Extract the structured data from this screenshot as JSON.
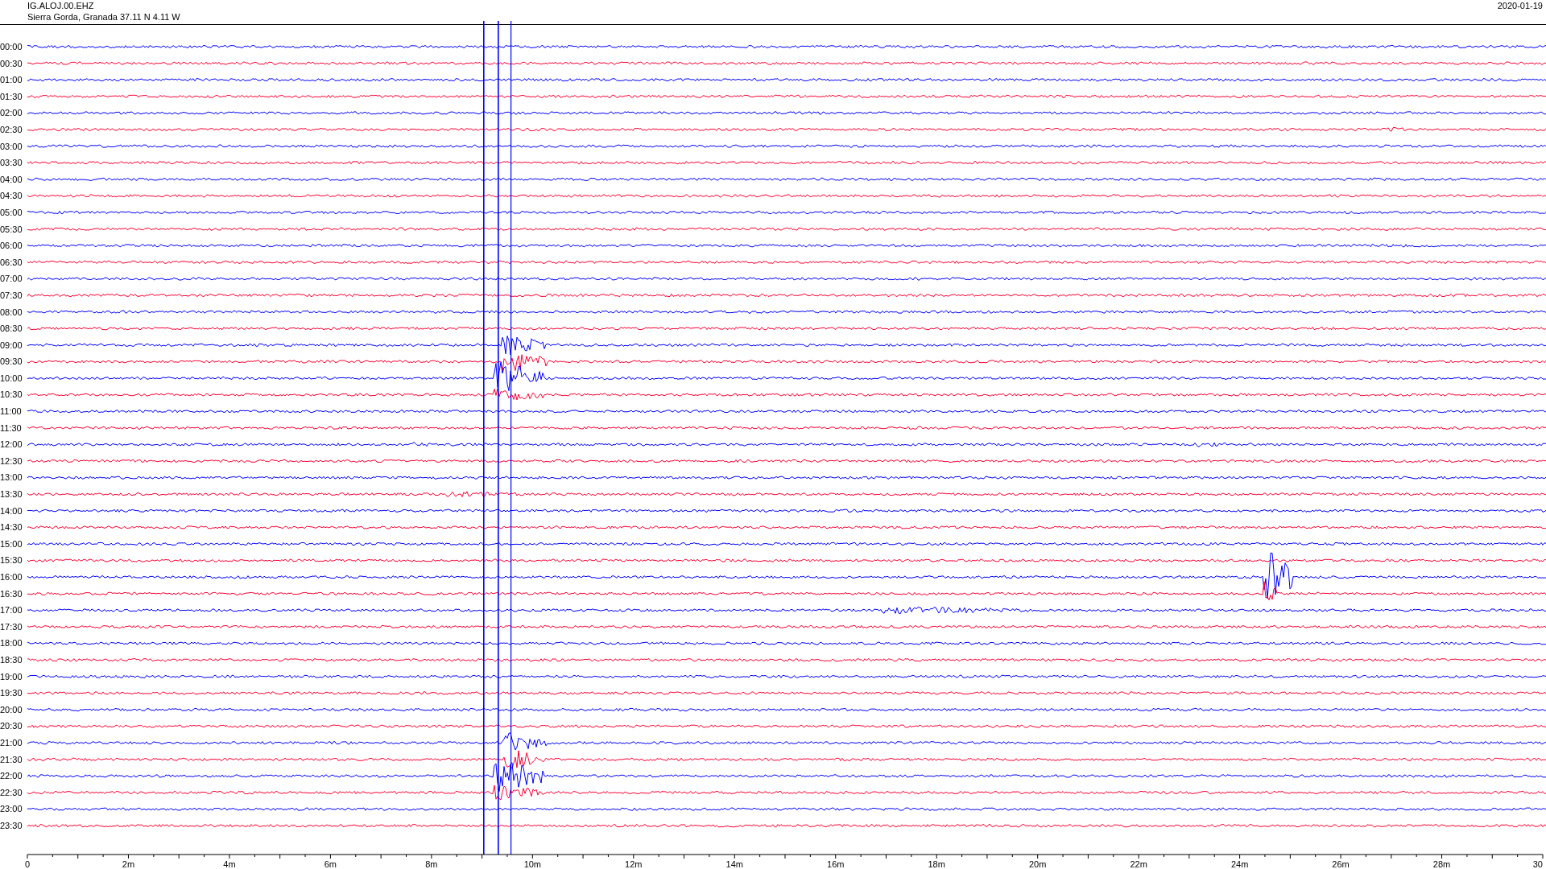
{
  "header": {
    "station": "IG.ALOJ.00.EHZ",
    "location": "Sierra Gorda, Granada  37.11 N 4.11 W",
    "date": "2020-01-19"
  },
  "rows": [
    {
      "time": "00:00",
      "color": "#0000ff"
    },
    {
      "time": "00:30",
      "color": "#ff0033"
    },
    {
      "time": "01:00",
      "color": "#0000ff"
    },
    {
      "time": "01:30",
      "color": "#ff0033"
    },
    {
      "time": "02:00",
      "color": "#0000ff"
    },
    {
      "time": "02:30",
      "color": "#ff0033"
    },
    {
      "time": "03:00",
      "color": "#0000ff"
    },
    {
      "time": "03:30",
      "color": "#ff0033"
    },
    {
      "time": "04:00",
      "color": "#0000ff"
    },
    {
      "time": "04:30",
      "color": "#ff0033"
    },
    {
      "time": "05:00",
      "color": "#0000ff"
    },
    {
      "time": "05:30",
      "color": "#ff0033"
    },
    {
      "time": "06:00",
      "color": "#0000ff"
    },
    {
      "time": "06:30",
      "color": "#ff0033"
    },
    {
      "time": "07:00",
      "color": "#0000ff"
    },
    {
      "time": "07:30",
      "color": "#ff0033"
    },
    {
      "time": "08:00",
      "color": "#0000ff"
    },
    {
      "time": "08:30",
      "color": "#ff0033"
    },
    {
      "time": "09:00",
      "color": "#0000ff"
    },
    {
      "time": "09:30",
      "color": "#ff0033"
    },
    {
      "time": "10:00",
      "color": "#0000ff"
    },
    {
      "time": "10:30",
      "color": "#ff0033"
    },
    {
      "time": "11:00",
      "color": "#0000ff"
    },
    {
      "time": "11:30",
      "color": "#ff0033"
    },
    {
      "time": "12:00",
      "color": "#0000ff"
    },
    {
      "time": "12:30",
      "color": "#ff0033"
    },
    {
      "time": "13:00",
      "color": "#0000ff"
    },
    {
      "time": "13:30",
      "color": "#ff0033"
    },
    {
      "time": "14:00",
      "color": "#0000ff"
    },
    {
      "time": "14:30",
      "color": "#ff0033"
    },
    {
      "time": "15:00",
      "color": "#0000ff"
    },
    {
      "time": "15:30",
      "color": "#ff0033"
    },
    {
      "time": "16:00",
      "color": "#0000ff"
    },
    {
      "time": "16:30",
      "color": "#ff0033"
    },
    {
      "time": "17:00",
      "color": "#0000ff"
    },
    {
      "time": "17:30",
      "color": "#ff0033"
    },
    {
      "time": "18:00",
      "color": "#0000ff"
    },
    {
      "time": "18:30",
      "color": "#ff0033"
    },
    {
      "time": "19:00",
      "color": "#0000ff"
    },
    {
      "time": "19:30",
      "color": "#ff0033"
    },
    {
      "time": "20:00",
      "color": "#0000ff"
    },
    {
      "time": "20:30",
      "color": "#ff0033"
    },
    {
      "time": "21:00",
      "color": "#0000ff"
    },
    {
      "time": "21:30",
      "color": "#ff0033"
    },
    {
      "time": "22:00",
      "color": "#0000ff"
    },
    {
      "time": "22:30",
      "color": "#ff0033"
    },
    {
      "time": "23:00",
      "color": "#0000ff"
    },
    {
      "time": "23:30",
      "color": "#ff0033"
    }
  ],
  "x_axis": {
    "labels": [
      "0",
      "2m",
      "4m",
      "6m",
      "8m",
      "10m",
      "12m",
      "14m",
      "16m",
      "18m",
      "20m",
      "22m",
      "24m",
      "26m",
      "28m",
      "30"
    ]
  }
}
